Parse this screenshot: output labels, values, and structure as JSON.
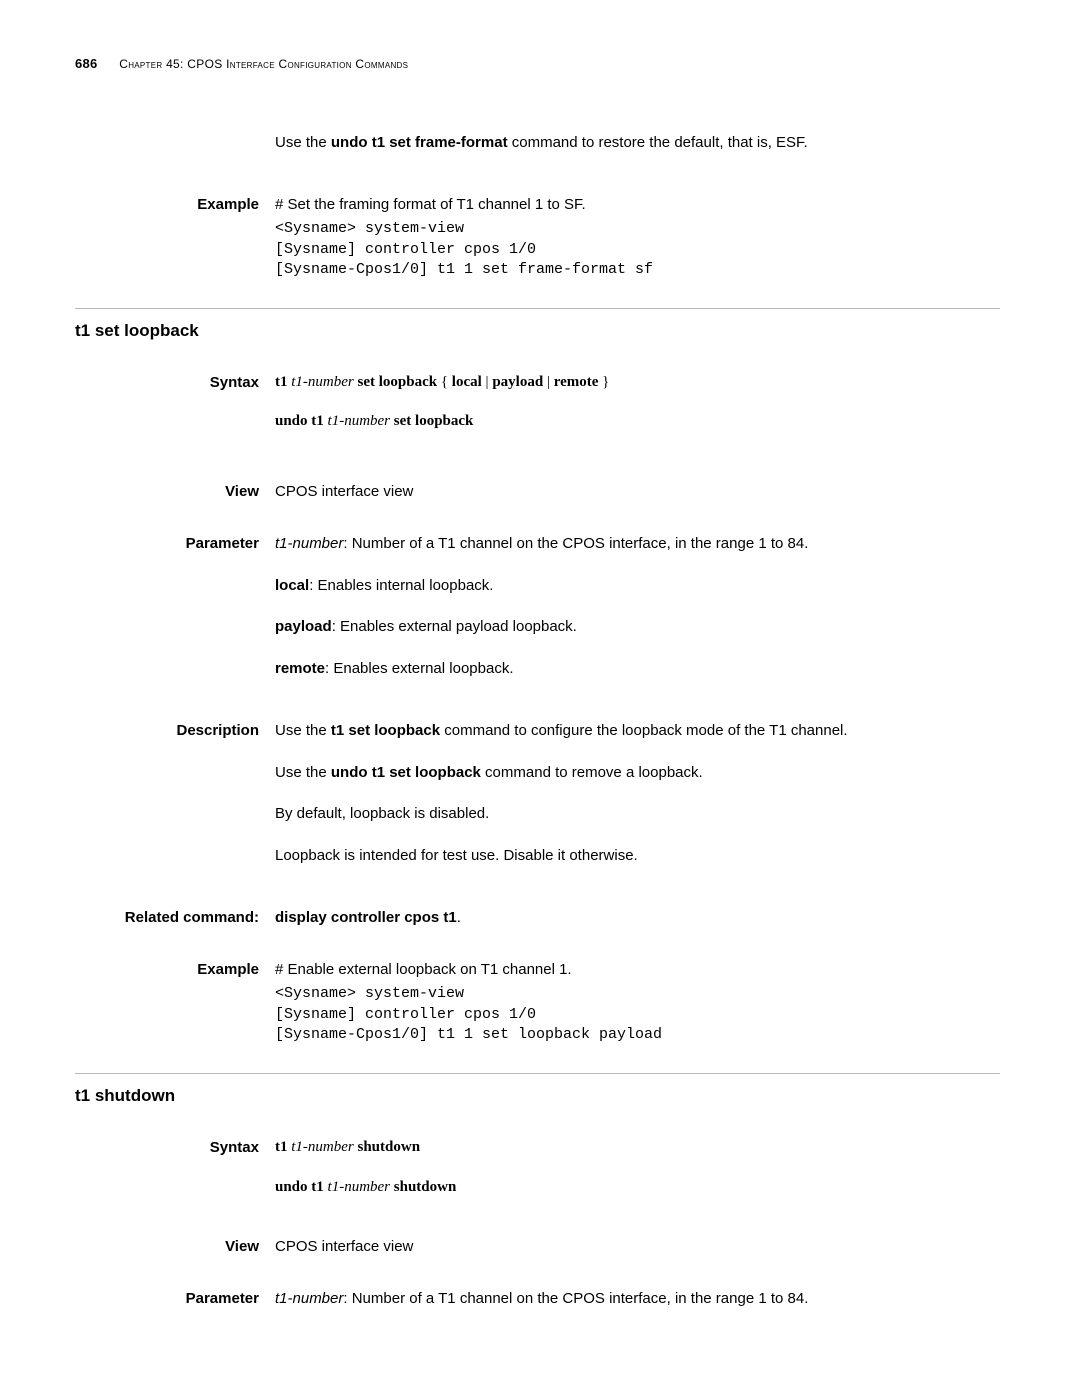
{
  "header": {
    "page_number": "686",
    "chapter": "Chapter 45: CPOS Interface Configuration Commands"
  },
  "intro": {
    "use_undo_pre": "Use the ",
    "use_undo_cmd": "undo t1 set frame-format",
    "use_undo_post": " command to restore the default, that is, ESF."
  },
  "labels": {
    "example": "Example",
    "syntax": "Syntax",
    "view": "View",
    "parameter": "Parameter",
    "description": "Description",
    "related": "Related command:"
  },
  "example1": {
    "desc": "# Set the framing format of T1 channel 1 to SF.",
    "code": "<Sysname> system-view\n[Sysname] controller cpos 1/0\n[Sysname-Cpos1/0] t1 1 set frame-format sf"
  },
  "sec1": {
    "title": "t1 set loopback",
    "syntax": {
      "t1": "t1",
      "t1num": " t1-number ",
      "set_lb": "set loopback",
      "brace_open": " { ",
      "local": "local",
      "pipe1": " | ",
      "payload": "payload",
      "pipe2": " | ",
      "remote": "remote",
      "brace_close": " }",
      "undo": "undo t1",
      "undo_num": " t1-number ",
      "undo_set": "set loopback"
    },
    "view": "CPOS interface view",
    "param": {
      "p1_key": "t1-number",
      "p1_txt": ": Number of a T1 channel on the CPOS interface, in the range 1 to 84.",
      "p2_key": "local",
      "p2_txt": ": Enables internal loopback.",
      "p3_key": "payload",
      "p3_txt": ": Enables external payload loopback.",
      "p4_key": "remote",
      "p4_txt": ": Enables external loopback."
    },
    "desc": {
      "d1_pre": "Use the ",
      "d1_cmd": "t1 set loopback",
      "d1_post": " command to configure the loopback mode of the T1 channel.",
      "d2_pre": "Use the ",
      "d2_cmd": "undo t1 set loopback",
      "d2_post": " command to remove a loopback.",
      "d3": "By default, loopback is disabled.",
      "d4": "Loopback is intended for test use. Disable it otherwise."
    },
    "related": {
      "cmd": "display controller cpos t1",
      "dot": "."
    },
    "example": {
      "desc": "# Enable external loopback on T1 channel 1.",
      "code": "<Sysname> system-view\n[Sysname] controller cpos 1/0\n[Sysname-Cpos1/0] t1 1 set loopback payload"
    }
  },
  "sec2": {
    "title": "t1 shutdown",
    "syntax": {
      "t1": "t1",
      "t1num": " t1-number ",
      "shutdown": "shutdown",
      "undo": "undo t1",
      "undo_num": " t1-number ",
      "undo_sd": "shutdown"
    },
    "view": "CPOS interface view",
    "param": {
      "p1_key": "t1-number",
      "p1_txt": ": Number of a T1 channel on the CPOS interface, in the range 1 to 84."
    }
  }
}
